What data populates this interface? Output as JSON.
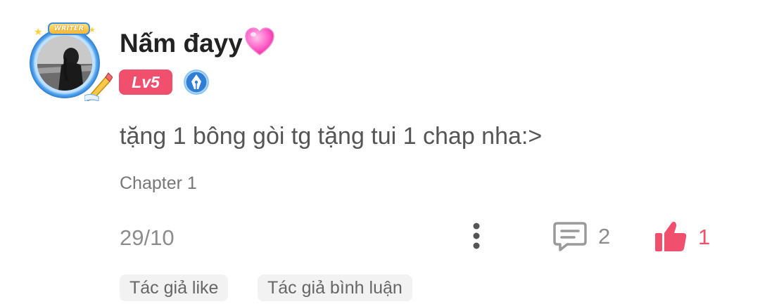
{
  "user": {
    "name": "Nấm đayy",
    "writer_badge": "WRITER",
    "level_badge": "Lv5"
  },
  "comment": {
    "text": "tặng 1 bông gòi tg tặng tui 1 chap nha:>",
    "chapter": "Chapter 1",
    "date": "29/10"
  },
  "actions": {
    "comment_count": "2",
    "like_count": "1"
  },
  "tags": [
    "Tác giả like",
    "Tác giả bình luận"
  ],
  "icons": {
    "heart": "pink-heart-icon",
    "author": "pen-nib-badge-icon",
    "more": "more-vertical-icon",
    "comment": "comment-bubble-icon",
    "like": "thumbs-up-icon"
  },
  "colors": {
    "accent": "#f0506e",
    "text_primary": "#222222",
    "text_secondary": "#555555",
    "text_muted": "#8c8c8c",
    "tag_bg": "#f2f2f2",
    "badge_blue": "#2f7fd6"
  }
}
